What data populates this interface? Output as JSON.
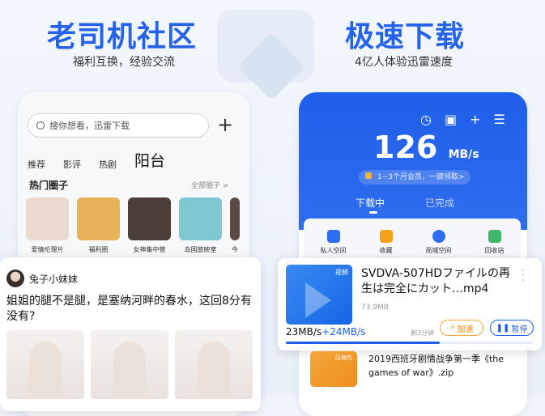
{
  "left_header": {
    "title": "老司机社区",
    "subtitle": "福利互换，经验交流"
  },
  "right_header": {
    "title": "极速下载",
    "subtitle": "4亿人体验迅雷速度"
  },
  "community": {
    "search_placeholder": "搜你想看，迅雷下载",
    "add_icon": "plus-icon",
    "tabs": [
      {
        "label": "推荐"
      },
      {
        "label": "影评"
      },
      {
        "label": "热剧"
      },
      {
        "label": "阳台"
      }
    ],
    "section_title": "热门圈子",
    "section_more": "全部圈子 >",
    "circles": [
      {
        "label": "爱情伦理片",
        "color": "#e9d9cf"
      },
      {
        "label": "福利圈",
        "color": "#e7b25a"
      },
      {
        "label": "女神集中营",
        "color": "#4c3f3a"
      },
      {
        "label": "岛国旅映室",
        "color": "#7fc8d3"
      },
      {
        "label": "今",
        "color": "#5b4a41"
      }
    ],
    "post": {
      "username": "兔子小妹妹",
      "text": "姐姐的腿不是腿，是塞纳河畔的春水，这回8分有没有?"
    }
  },
  "downloader": {
    "top_icons": [
      "timer-icon",
      "window-icon",
      "plus-icon",
      "menu-icon"
    ],
    "speed_value": "126",
    "speed_unit": "MB/s",
    "promo_text": "1~3个月会员，一键领取>",
    "tabs": [
      {
        "label": "下载中"
      },
      {
        "label": "已完成"
      }
    ],
    "shortcuts": [
      {
        "label": "私人空间",
        "icon": "lock-icon",
        "color": "#2f6df0"
      },
      {
        "label": "收藏",
        "icon": "star-icon",
        "color": "#f3a21a"
      },
      {
        "label": "局域空间",
        "icon": "network-icon",
        "color": "#2f6df0"
      },
      {
        "label": "回收站",
        "icon": "trash-icon",
        "color": "#3fb66b"
      }
    ],
    "active_task": {
      "thumb_tag": "视频",
      "file_name": "SVDVA-507HDファイルの再生は完全にカット…mp4",
      "file_size": "73.9MB",
      "rate": "23MB/s",
      "boost": "+24MB/s",
      "remaining": "剩3分钟",
      "accelerate_label": "加速",
      "pause_label": "暂停",
      "progress": 0.62
    },
    "next_task": {
      "thumb_tag": "压缩包",
      "file_name": "2019西班牙剧情战争第一季《the games of war》.zip"
    }
  }
}
